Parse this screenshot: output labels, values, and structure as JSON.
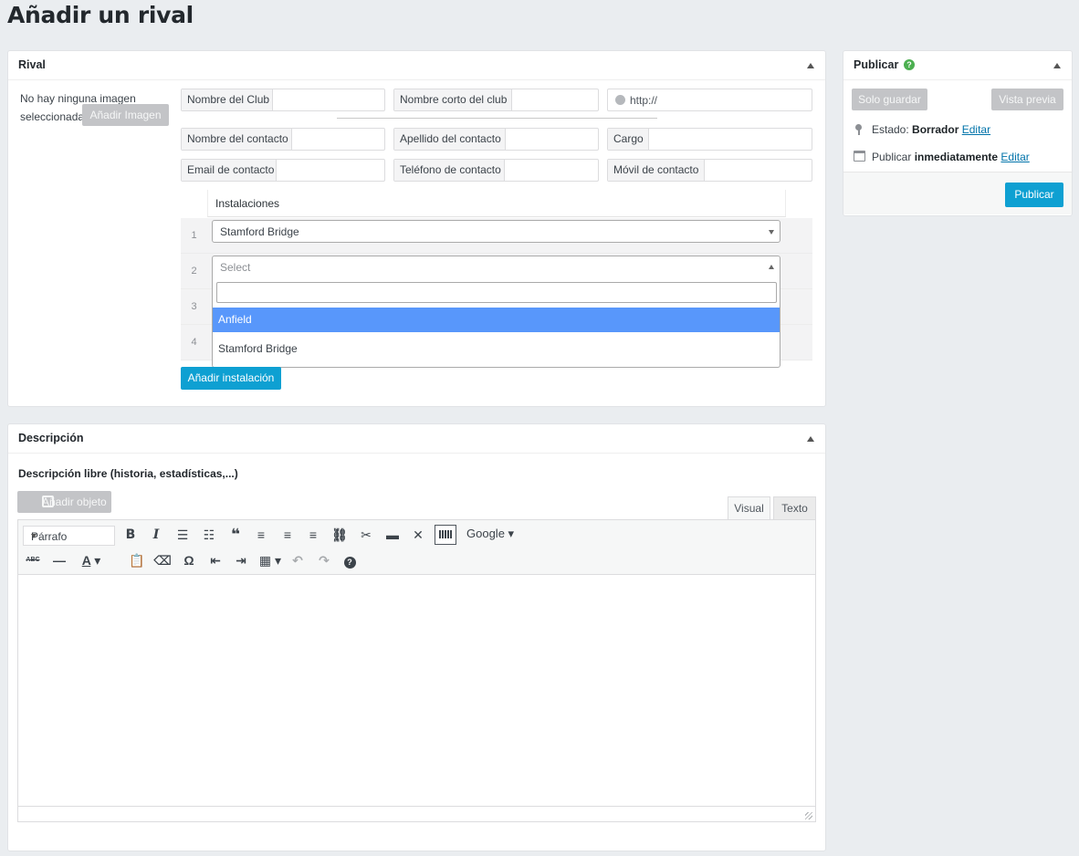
{
  "page": {
    "title": "Añadir un rival"
  },
  "rival": {
    "title": "Rival",
    "no_image": "No hay ninguna imagen",
    "no_image_2": "seleccionada",
    "add_image": "Añadir Imagen",
    "fields": {
      "club_name": "Nombre del Club",
      "club_short": "Nombre corto del club",
      "url_placeholder": "http://",
      "contact_name": "Nombre del contacto",
      "contact_surname": "Apellido del contacto",
      "position": "Cargo",
      "email": "Email de contacto",
      "phone": "Teléfono de contacto",
      "mobile": "Móvil de contacto"
    },
    "installations": {
      "header": "Instalaciones",
      "rows": [
        "1",
        "2",
        "3",
        "4"
      ],
      "row1_value": "Stamford Bridge",
      "row2_placeholder": "Select",
      "options": [
        "Anfield",
        "Stamford Bridge"
      ],
      "add_button": "Añadir instalación"
    }
  },
  "publish": {
    "title": "Publicar",
    "help": "?",
    "save_button": "Solo guardar",
    "preview_button": "Vista previa",
    "status_label": "Estado:",
    "status_value": "Borrador",
    "status_edit": "Editar",
    "publish_label": "Publicar",
    "publish_value": "inmediatamente",
    "publish_edit": "Editar",
    "publish_button": "Publicar"
  },
  "description": {
    "title": "Descripción",
    "label": "Descripción libre (historia, estadísticas,...)",
    "add_object": "Añadir objeto",
    "tab_visual": "Visual",
    "tab_text": "Texto",
    "format_select": "Párrafo",
    "font_menu": "Google",
    "toolbar_glyphs": {
      "bold": "B",
      "italic": "I",
      "blockquote": "❝",
      "strike": "ABC",
      "hr": "—",
      "color": "A",
      "omega": "Ω",
      "help": "?"
    }
  },
  "colors": {
    "accent_blue": "#0ea0d2",
    "highlight": "#5897fb",
    "link": "#0073aa",
    "help_green": "#4caf50"
  }
}
